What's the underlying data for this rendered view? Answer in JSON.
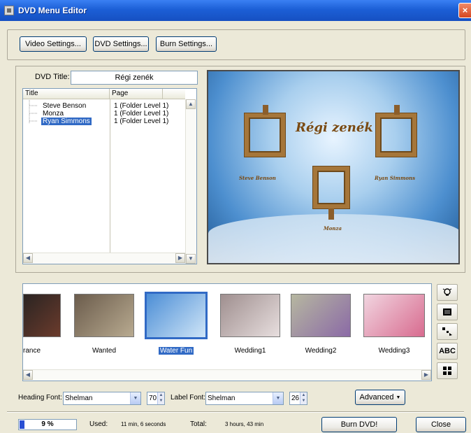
{
  "window": {
    "title": "DVD Menu Editor",
    "close_glyph": "×"
  },
  "toolbar": {
    "video_settings": "Video Settings...",
    "dvd_settings": "DVD Settings...",
    "burn_settings": "Burn Settings..."
  },
  "dvd_title": {
    "label": "DVD Title:",
    "value": "Régi zenék"
  },
  "list": {
    "columns": [
      "Title",
      "Page"
    ],
    "rows": [
      {
        "title": "Steve Benson",
        "page": "1 (Folder Level 1)"
      },
      {
        "title": "Monza",
        "page": "1 (Folder Level 1)"
      },
      {
        "title": "Ryan Simmons",
        "page": "1 (Folder Level 1)",
        "selected": true
      }
    ]
  },
  "preview": {
    "heading": "Régi zenék",
    "labels": [
      "Steve Benson",
      "Ryan Simmons",
      "Monza"
    ]
  },
  "templates": [
    {
      "label": "rance",
      "colors": [
        "#2a2422",
        "#6b3b2c"
      ]
    },
    {
      "label": "Wanted",
      "colors": [
        "#6b5c4c",
        "#b8aa90"
      ]
    },
    {
      "label": "Water Fun",
      "colors": [
        "#4c8ed6",
        "#cfe5f7"
      ],
      "selected": true
    },
    {
      "label": "Wedding1",
      "colors": [
        "#9f8f8f",
        "#e7dede"
      ]
    },
    {
      "label": "Wedding2",
      "colors": [
        "#b6b7a0",
        "#8b6aa6"
      ]
    },
    {
      "label": "Wedding3",
      "colors": [
        "#f1d5e0",
        "#d86b8f"
      ]
    }
  ],
  "tools": [
    "lightbulb-icon",
    "frame-icon",
    "arrange-icon",
    "ABC",
    "grid-icon"
  ],
  "fonts": {
    "heading_label": "Heading Font:",
    "heading_value": "Shelman",
    "heading_size": "70",
    "label_label": "Label Font:",
    "label_value": "Shelman",
    "label_size": "26",
    "advanced": "Advanced"
  },
  "status": {
    "progress_percent": 9,
    "progress_text": "9 %",
    "used_label": "Used:",
    "used_value": "11 min, 6 seconds",
    "total_label": "Total:",
    "total_value": "3 hours, 43 min",
    "burn_button": "Burn DVD!",
    "close_button": "Close"
  },
  "colors": {
    "titlebar": "#1c5fd6",
    "selection": "#316ac5",
    "background": "#ece9d8"
  }
}
